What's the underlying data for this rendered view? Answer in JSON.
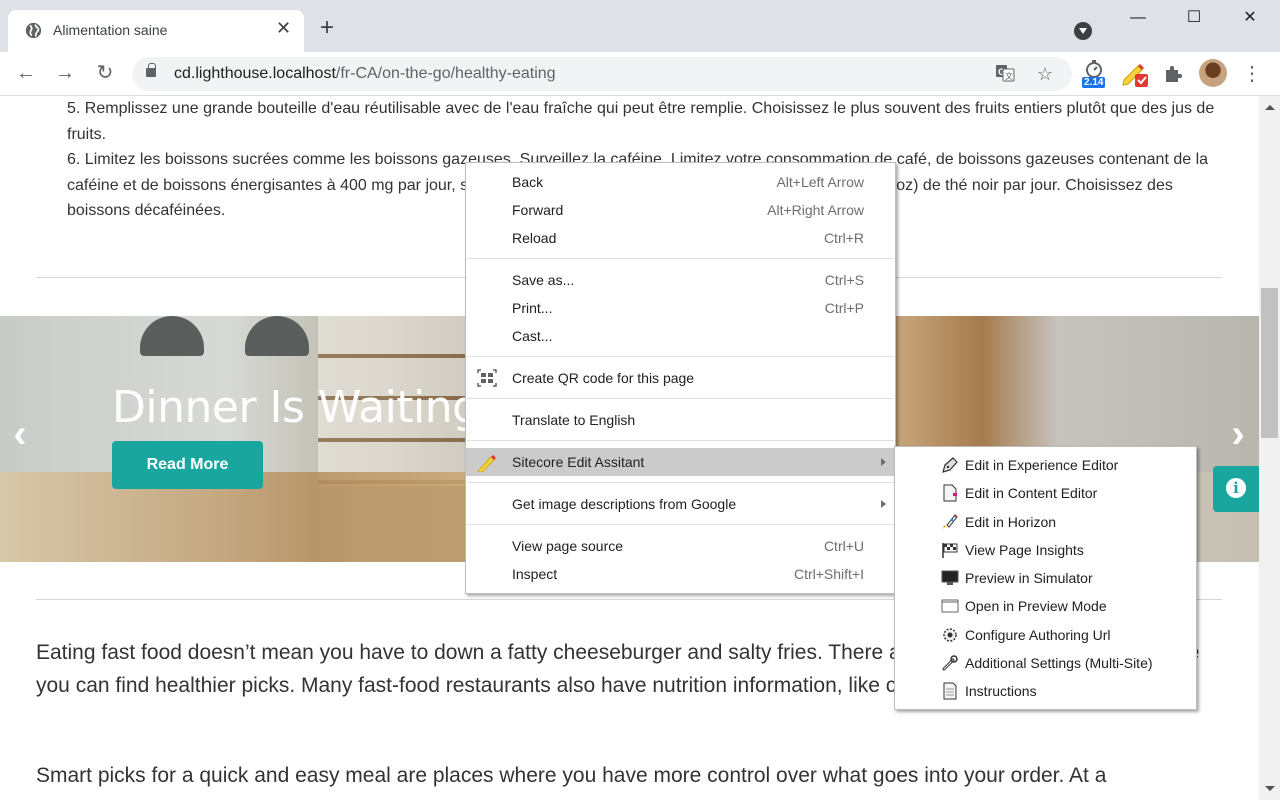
{
  "browser": {
    "tab": {
      "title": "Alimentation saine",
      "icon": "globe-icon"
    },
    "new_tab_label": "+",
    "window_controls": {
      "minimize": "—",
      "maximize": "☐",
      "close": "✕"
    },
    "nav": {
      "back": "←",
      "forward": "→",
      "reload": "↻"
    },
    "url": {
      "host": "cd.lighthouse.localhost",
      "path": "/fr-CA/on-the-go/healthy-eating"
    },
    "extensions": {
      "timer_badge": "2.14"
    }
  },
  "page": {
    "list_item_5": "5. Remplissez une grande bouteille d'eau réutilisable avec de l'eau fraîche qui peut être remplie. Choisissez le plus souvent des fruits entiers plutôt que des jus de fruits.",
    "list_item_6": "6. Limitez les boissons sucrées comme les boissons gazeuses. Surveillez la caféine. Limitez votre consommation de café, de boissons gazeuses contenant de la caféine et de boissons énergisantes à 400 mg par jour, soit environ 3 tasses de café ordinaire ou 8 tasses (2 L ou 64 oz) de thé noir par jour. Choisissez des boissons décaféinées.",
    "hero": {
      "title": "Dinner Is Waiting",
      "button": "Read More",
      "prev": "‹",
      "next": "›",
      "info": "i"
    },
    "paragraph_1": "Eating fast food doesn’t mean you have to down a fatty cheeseburger and salty fries. There are plenty of menu options where you can find healthier picks. Many fast-food restaurants also have nutrition information, like calorie counts, online.",
    "paragraph_2": "Smart picks for a quick and easy meal are places where you have more control over what goes into your order. At a"
  },
  "context_menu": {
    "groups": [
      [
        {
          "label": "Back",
          "shortcut": "Alt+Left Arrow"
        },
        {
          "label": "Forward",
          "shortcut": "Alt+Right Arrow"
        },
        {
          "label": "Reload",
          "shortcut": "Ctrl+R"
        }
      ],
      [
        {
          "label": "Save as...",
          "shortcut": "Ctrl+S"
        },
        {
          "label": "Print...",
          "shortcut": "Ctrl+P"
        },
        {
          "label": "Cast...",
          "shortcut": ""
        }
      ],
      [
        {
          "label": "Create QR code for this page",
          "icon": "qr-code-icon"
        }
      ],
      [
        {
          "label": "Translate to English"
        }
      ],
      [
        {
          "label": "Sitecore Edit Assitant",
          "icon": "pencil-icon",
          "submenu": true,
          "highlighted": true
        }
      ],
      [
        {
          "label": "Get image descriptions from Google",
          "submenu": true
        }
      ],
      [
        {
          "label": "View page source",
          "shortcut": "Ctrl+U"
        },
        {
          "label": "Inspect",
          "shortcut": "Ctrl+Shift+I"
        }
      ]
    ]
  },
  "submenu": {
    "items": [
      {
        "label": "Edit in Experience Editor",
        "icon": "pen-nib-icon"
      },
      {
        "label": "Edit in Content Editor",
        "icon": "document-edit-icon"
      },
      {
        "label": "Edit in Horizon",
        "icon": "rocket-icon"
      },
      {
        "label": "View Page Insights",
        "icon": "checkered-flag-icon"
      },
      {
        "label": "Preview in Simulator",
        "icon": "monitor-icon"
      },
      {
        "label": "Open in Preview Mode",
        "icon": "window-icon"
      },
      {
        "label": "Configure Authoring Url",
        "icon": "gear-icon"
      },
      {
        "label": "Additional Settings (Multi-Site)",
        "icon": "wrench-icon"
      },
      {
        "label": "Instructions",
        "icon": "document-icon"
      }
    ]
  },
  "colors": {
    "accent": "#18a69f",
    "menu_highlight": "#cbcbcb",
    "badge_blue": "#1a73e8"
  }
}
